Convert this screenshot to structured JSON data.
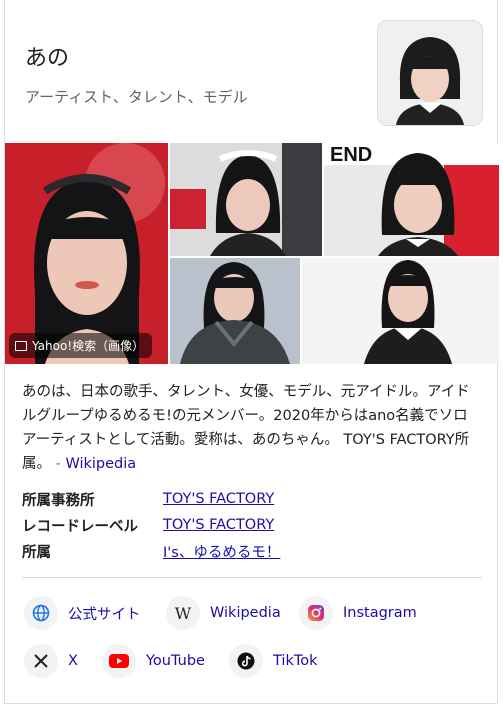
{
  "header": {
    "title": "あの",
    "subtitle": "アーティスト、タレント、モデル"
  },
  "gallery": {
    "badge_label": "Yahoo!検索（画像）"
  },
  "description": {
    "text": "あのは、日本の歌手、タレント、女優、モデル、元アイドル。アイドルグループゆるめるモ!の元メンバー。2020年からはano名義でソロアーティストとして活動。愛称は、あのちゃん。 TOY'S FACTORY所属。",
    "separator": "-",
    "source_label": "Wikipedia"
  },
  "facts": [
    {
      "key": "所属事務所",
      "value": "TOY'S FACTORY"
    },
    {
      "key": "レコードレーベル",
      "value": "TOY'S FACTORY"
    },
    {
      "key": "所属",
      "value": "I's、ゆるめるモ！"
    }
  ],
  "links": [
    {
      "label": "公式サイト",
      "icon": "globe-icon"
    },
    {
      "label": "Wikipedia",
      "icon": "wikipedia-icon"
    },
    {
      "label": "Instagram",
      "icon": "instagram-icon"
    },
    {
      "label": "X",
      "icon": "x-icon"
    },
    {
      "label": "YouTube",
      "icon": "youtube-icon"
    },
    {
      "label": "TikTok",
      "icon": "tiktok-icon"
    }
  ],
  "colors": {
    "link": "#1a0dab",
    "text": "#202124",
    "muted": "#5f6368"
  }
}
